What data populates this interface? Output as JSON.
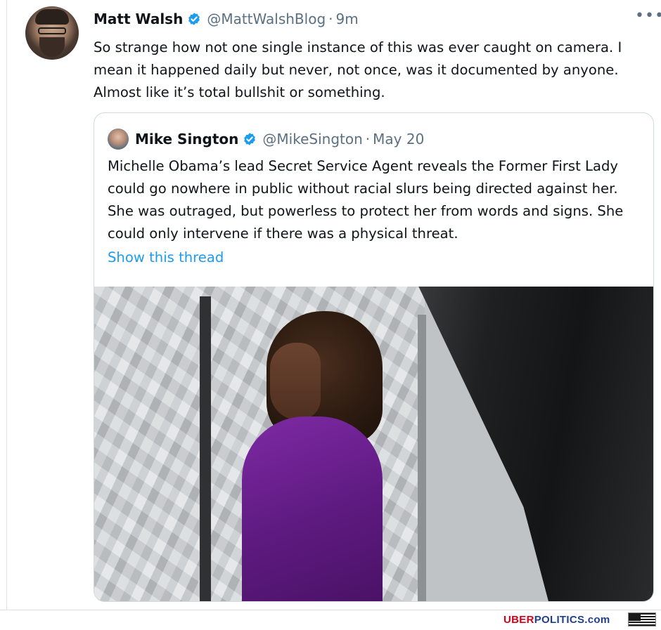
{
  "tweet": {
    "author_name": "Matt Walsh",
    "handle": "@MattWalshBlog",
    "separator": "·",
    "time": "9m",
    "more": "•••",
    "text": "So strange how not one single instance of this was ever caught on camera. I mean it happened daily but never, not once, was it documented by anyone. Almost like it’s total bullshit or something."
  },
  "quoted": {
    "author_name": "Mike Sington",
    "handle": "@MikeSington",
    "separator": "·",
    "time": "May 20",
    "text": "Michelle Obama’s lead Secret Service Agent reveals the Former First Lady could go nowhere in public without racial slurs being directed against her. She was outraged, but powerless to protect her from words and signs. She could only intervene if there was a physical threat.",
    "show_thread": "Show this thread"
  },
  "footer": {
    "brand_red": "UBER",
    "brand_blue": "POLITICS.com"
  },
  "colors": {
    "link_blue": "#1d9bf0",
    "muted": "#5b7083",
    "verified": "#1d9bf0",
    "brand_red": "#d0021b",
    "brand_blue": "#1f3f8f"
  },
  "icons": {
    "verified": "verified-badge-icon",
    "more": "more-horizontal-icon",
    "flag": "us-flag-icon"
  }
}
